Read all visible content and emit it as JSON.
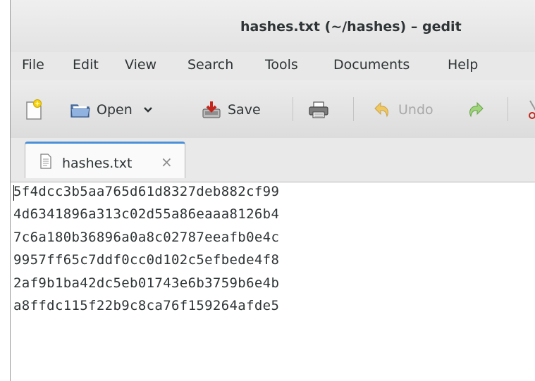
{
  "window": {
    "title": "hashes.txt (~/hashes) – gedit"
  },
  "menubar": {
    "items": [
      "File",
      "Edit",
      "View",
      "Search",
      "Tools",
      "Documents",
      "Help"
    ]
  },
  "toolbar": {
    "new_icon": "new-document-icon",
    "open_label": "Open",
    "save_label": "Save",
    "undo_label": "Undo",
    "redo_icon": "redo-icon",
    "print_icon": "print-icon"
  },
  "tab": {
    "label": "hashes.txt",
    "close": "×"
  },
  "document": {
    "lines": [
      "5f4dcc3b5aa765d61d8327deb882cf99",
      "4d6341896a313c02d55a86eaaa8126b4",
      "7c6a180b36896a0a8c02787eeafb0e4c",
      "9957ff65c7ddf0cc0d102c5efbede4f8",
      "2af9b1ba42dc5eb01743e6b3759b6e4b",
      "a8ffdc115f22b9c8ca76f159264afde5"
    ]
  }
}
